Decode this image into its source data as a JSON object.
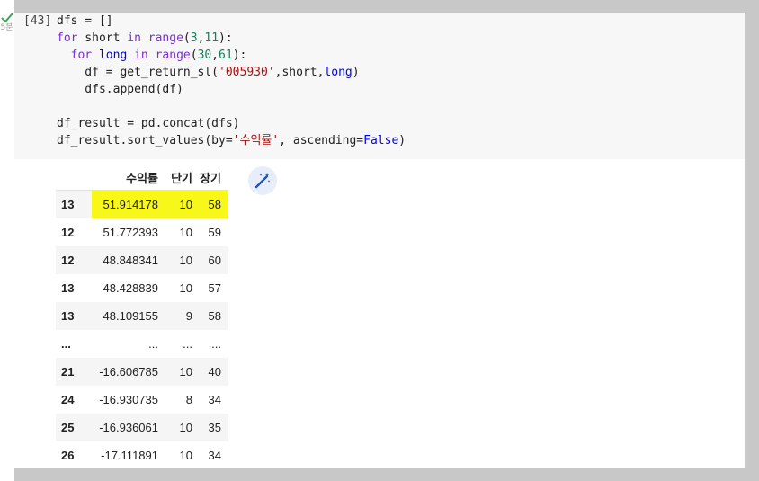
{
  "run_status": {
    "time": "5분"
  },
  "cell": {
    "execution_count": "[43]",
    "code_lines": [
      "dfs = []",
      "for short in range(3,11):",
      "  for long in range(30,61):",
      "    df = get_return_sl('005930',short,long)",
      "    dfs.append(df)",
      "",
      "df_result = pd.concat(dfs)",
      "df_result.sort_values(by='수익률', ascending=False)"
    ]
  },
  "table": {
    "columns": [
      "",
      "수익률",
      "단기",
      "장기"
    ],
    "rows": [
      [
        "13",
        "51.914178",
        "10",
        "58"
      ],
      [
        "12",
        "51.772393",
        "10",
        "59"
      ],
      [
        "12",
        "48.848341",
        "10",
        "60"
      ],
      [
        "13",
        "48.428839",
        "10",
        "57"
      ],
      [
        "13",
        "48.109155",
        "9",
        "58"
      ],
      [
        "...",
        "...",
        "...",
        "..."
      ],
      [
        "21",
        "-16.606785",
        "10",
        "40"
      ],
      [
        "24",
        "-16.930735",
        "8",
        "34"
      ],
      [
        "25",
        "-16.936061",
        "10",
        "35"
      ],
      [
        "26",
        "-17.111891",
        "10",
        "34"
      ]
    ],
    "highlighted_row": 0,
    "highlight_color": "#f7f719"
  },
  "colors": {
    "code_background": "#f7f7f7",
    "keyword": "#7b30d0",
    "number": "#098658",
    "string": "#a31515",
    "check": "#34a853"
  },
  "icons": {
    "run_status": "check-icon",
    "magic": "magic-wand-icon"
  }
}
